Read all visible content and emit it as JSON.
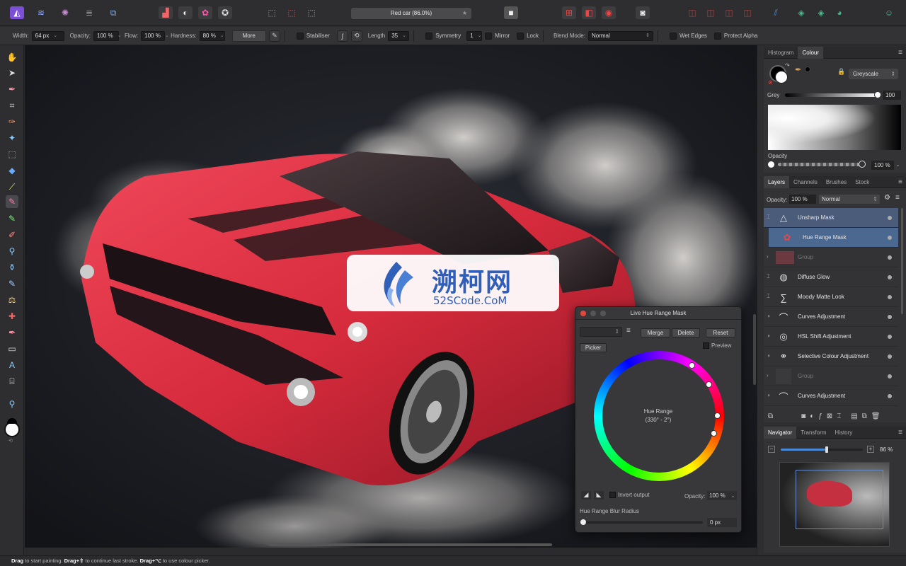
{
  "document_title": "Red car (86.0%)",
  "context": {
    "width_label": "Width:",
    "width_value": "64 px",
    "opacity_label": "Opacity:",
    "opacity_value": "100 %",
    "flow_label": "Flow:",
    "flow_value": "100 %",
    "hardness_label": "Hardness:",
    "hardness_value": "80 %",
    "more_label": "More",
    "stabiliser_label": "Stabiliser",
    "length_label": "Length",
    "length_value": "35",
    "symmetry_label": "Symmetry",
    "symmetry_value": "1",
    "mirror_label": "Mirror",
    "lock_label": "Lock",
    "blend_label": "Blend Mode:",
    "blend_value": "Normal",
    "wet_edges_label": "Wet Edges",
    "protect_alpha_label": "Protect Alpha"
  },
  "colour_panel": {
    "tabs": [
      "Histogram",
      "Colour"
    ],
    "mode": "Greyscale",
    "grey_label": "Grey",
    "grey_value": "100",
    "opacity_label": "Opacity",
    "opacity_value": "100 %"
  },
  "layers_panel": {
    "tabs": [
      "Layers",
      "Channels",
      "Brushes",
      "Stock"
    ],
    "opacity_label": "Opacity:",
    "opacity_value": "100 %",
    "blend_value": "Normal",
    "layers": [
      {
        "name": "Unsharp Mask",
        "icon": "triangle-icon",
        "selected": true
      },
      {
        "name": "Hue Range Mask",
        "icon": "hue-mask-icon",
        "selected": true
      },
      {
        "name": "Group",
        "icon": "group-thumb",
        "selected": false
      },
      {
        "name": "Diffuse Glow",
        "icon": "glow-icon",
        "selected": false
      },
      {
        "name": "Moody Matte Look",
        "icon": "sigma-icon",
        "selected": false
      },
      {
        "name": "Curves Adjustment",
        "icon": "curves-icon",
        "selected": false
      },
      {
        "name": "HSL Shift Adjustment",
        "icon": "hsl-icon",
        "selected": false
      },
      {
        "name": "Selective Colour Adjustment",
        "icon": "selective-colour-icon",
        "selected": false
      },
      {
        "name": "Group",
        "icon": "group-thumb",
        "selected": false
      },
      {
        "name": "Curves Adjustment",
        "icon": "curves-icon",
        "selected": false
      }
    ]
  },
  "navigator_panel": {
    "tabs": [
      "Navigator",
      "Transform",
      "History"
    ],
    "zoom_value": "86 %",
    "zoom_fraction": 0.54
  },
  "dialog": {
    "title": "Live Hue Range Mask",
    "merge_label": "Merge",
    "delete_label": "Delete",
    "reset_label": "Reset",
    "picker_label": "Picker",
    "preview_label": "Preview",
    "wheel_label": "Hue Range",
    "wheel_range": "(330° - 2°)",
    "invert_label": "Invert output",
    "opacity_label": "Opacity:",
    "opacity_value": "100 %",
    "blur_label": "Hue Range Blur Radius",
    "blur_value": "0 px"
  },
  "watermark": {
    "main": "溯柯网",
    "sub": "52SCode.CoM"
  },
  "status": {
    "b1": "Drag",
    "t1": " to start painting. ",
    "b2": "Drag+⇧",
    "t2": " to continue last stroke. ",
    "b3": "Drag+⌥",
    "t3": " to use colour picker."
  },
  "colors": {
    "accent": "#4b6fa8",
    "selected_layer": "#4a6890",
    "car": "#d62b3c"
  }
}
